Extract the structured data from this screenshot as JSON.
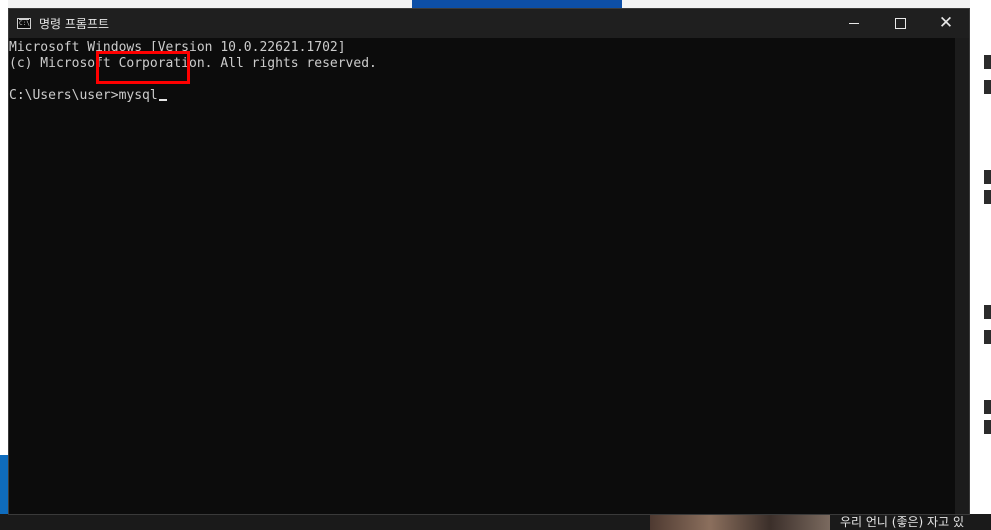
{
  "window": {
    "title": "명령 프롬프트",
    "icon": "cmd-icon",
    "controls": {
      "minimize": "minimize-icon",
      "maximize": "maximize-icon",
      "close": "close-icon"
    }
  },
  "console": {
    "lines": [
      "Microsoft Windows [Version 10.0.22621.1702]",
      "(c) Microsoft Corporation. All rights reserved.",
      "",
      "C:\\Users\\user>mysql"
    ]
  },
  "background": {
    "bottom_text": "우리 언니 (좋은) 자고 있"
  },
  "annotation": {
    "color": "#ff0000"
  }
}
